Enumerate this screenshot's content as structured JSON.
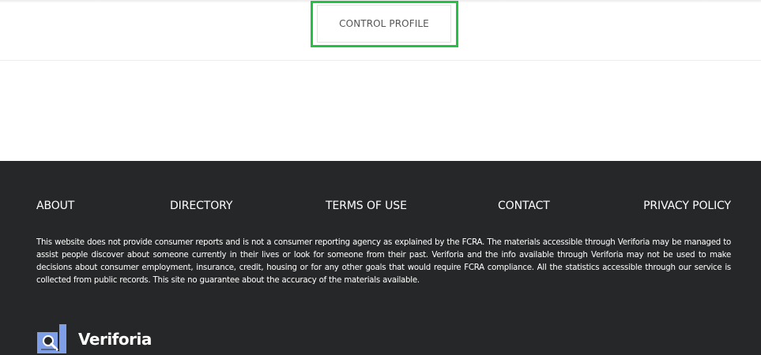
{
  "header": {
    "control_profile_label": "CONTROL PROFILE"
  },
  "footer": {
    "nav": [
      {
        "label": "ABOUT"
      },
      {
        "label": "DIRECTORY"
      },
      {
        "label": "TERMS OF USE"
      },
      {
        "label": "CONTACT"
      },
      {
        "label": "PRIVACY POLICY"
      }
    ],
    "disclaimer": "This website does not provide consumer reports and is not a consumer reporting agency as explained by the FCRA. The materials accessible through Veriforia may be managed to assist people discover about someone currently in their lives or look for someone from their past. Veriforia and the info available through Veriforia may not be used to make decisions about consumer employment, insurance, credit, housing or for any other goals that would require FCRA compliance. All the statistics accessible through our service is collected from public records. This site no guarantee about the accuracy of the materials available.",
    "brand": {
      "name": "Veriforia",
      "icon": "magnifier-document-icon"
    }
  },
  "colors": {
    "footer_background": "#262729",
    "highlight": "#22c244",
    "logo_blue": "#7e9fe8"
  }
}
